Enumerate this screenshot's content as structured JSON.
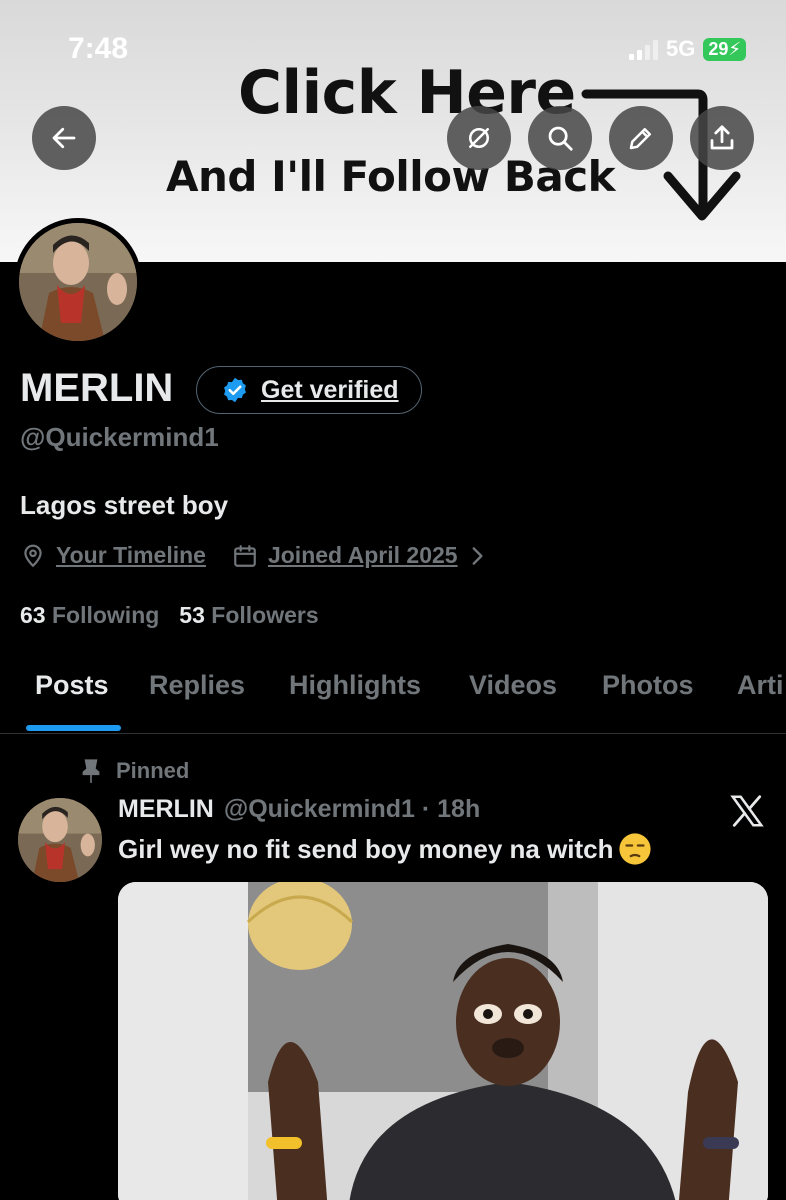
{
  "status_bar": {
    "time": "7:48",
    "network": "5G",
    "battery": "29"
  },
  "banner": {
    "line1": "Click Here",
    "line2": "And I'll Follow Back"
  },
  "header_buttons": [
    "back-icon",
    "grok-icon",
    "search-icon",
    "edit-icon",
    "share-icon"
  ],
  "profile": {
    "name": "MERLIN",
    "verify_label": "Get verified",
    "handle": "@Quickermind1",
    "bio": "Lagos street boy",
    "location": "Your Timeline",
    "joined": "Joined April 2025",
    "following_count": "63",
    "following_label": "Following",
    "followers_count": "53",
    "followers_label": "Followers"
  },
  "tabs": [
    "Posts",
    "Replies",
    "Highlights",
    "Videos",
    "Photos",
    "Arti"
  ],
  "active_tab": "Posts",
  "post": {
    "pinned_label": "Pinned",
    "name": "MERLIN",
    "meta": "@Quickermind1 · 18h",
    "text": "Girl wey no fit send boy money na witch"
  },
  "colors": {
    "accent": "#1d9bf0",
    "muted": "#71767b",
    "text": "#e7e9ea",
    "background": "#000000"
  }
}
